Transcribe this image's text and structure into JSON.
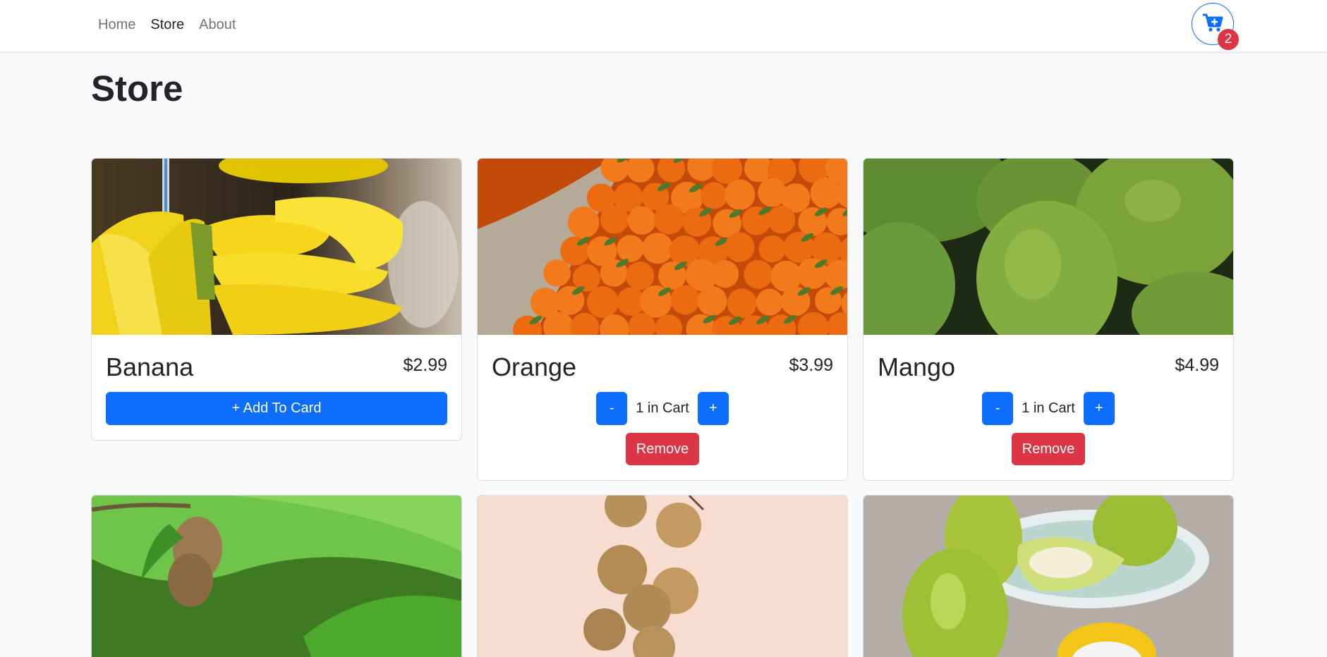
{
  "nav": {
    "links": [
      "Home",
      "Store",
      "About"
    ],
    "active": "Store",
    "cart_icon": "cart-plus-icon",
    "cart_count": "2"
  },
  "page": {
    "title": "Store"
  },
  "colors": {
    "primary": "#0d6efd",
    "danger": "#dc3545",
    "background": "#f8f9fa"
  },
  "products": [
    {
      "name": "Banana",
      "price": "$2.99",
      "in_cart": false,
      "add_label": "+ Add To Card"
    },
    {
      "name": "Orange",
      "price": "$3.99",
      "in_cart": true,
      "minus_label": "-",
      "cart_text": "1 in Cart",
      "plus_label": "+",
      "remove_label": "Remove"
    },
    {
      "name": "Mango",
      "price": "$4.99",
      "in_cart": true,
      "minus_label": "-",
      "cart_text": "1 in Cart",
      "plus_label": "+",
      "remove_label": "Remove"
    },
    {
      "name": "",
      "image": "sapodilla-photo"
    },
    {
      "name": "",
      "image": "longan-photo"
    },
    {
      "name": "",
      "image": "guava-photo"
    }
  ]
}
